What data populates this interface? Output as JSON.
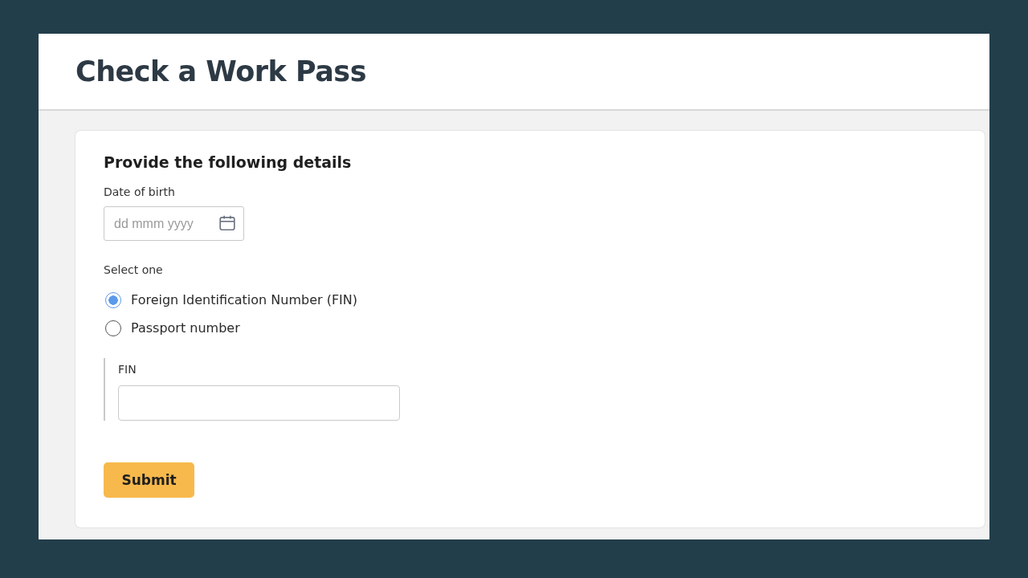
{
  "header": {
    "title": "Check a Work Pass"
  },
  "form": {
    "heading": "Provide the following details",
    "date_field": {
      "label": "Date of birth",
      "placeholder": "dd mmm yyyy"
    },
    "choice": {
      "label": "Select one",
      "options": [
        {
          "label": "Foreign Identification Number (FIN)",
          "selected": true
        },
        {
          "label": "Passport number",
          "selected": false
        }
      ]
    },
    "id_field": {
      "label": "FIN"
    },
    "submit": {
      "label": "Submit"
    }
  }
}
